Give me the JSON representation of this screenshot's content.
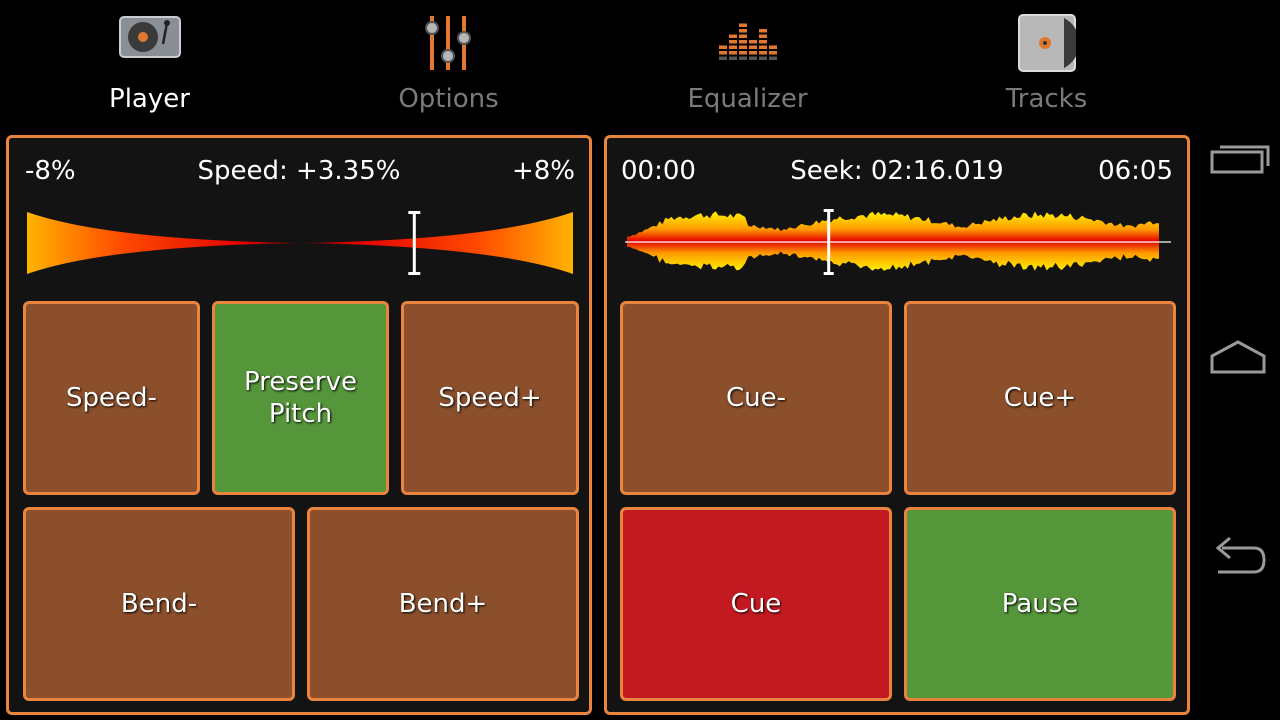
{
  "tabs": [
    {
      "label": "Player",
      "active": true,
      "icon": "turntable-icon"
    },
    {
      "label": "Options",
      "active": false,
      "icon": "sliders-icon"
    },
    {
      "label": "Equalizer",
      "active": false,
      "icon": "equalizer-icon"
    },
    {
      "label": "Tracks",
      "active": false,
      "icon": "record-sleeve-icon"
    }
  ],
  "speed": {
    "min_label": "-8%",
    "label": "Speed: +3.35%",
    "max_label": "+8%",
    "value_percent": 3.35,
    "range_percent": [
      -8,
      8
    ]
  },
  "seek": {
    "start_label": "00:00",
    "label": "Seek: 02:16.019",
    "end_label": "06:05",
    "position_fraction": 0.373
  },
  "pitch_buttons": {
    "speed_minus": "Speed-",
    "preserve_pitch": "Preserve Pitch",
    "speed_plus": "Speed+",
    "bend_minus": "Bend-",
    "bend_plus": "Bend+"
  },
  "transport_buttons": {
    "cue_minus": "Cue-",
    "cue_plus": "Cue+",
    "cue": "Cue",
    "pause": "Pause"
  },
  "colors": {
    "accent_border": "#e8843e",
    "button_brown": "#8b4f2b",
    "button_green": "#55963a",
    "button_red": "#c31a22"
  },
  "system_nav": [
    "recents-icon",
    "home-icon",
    "back-icon"
  ]
}
